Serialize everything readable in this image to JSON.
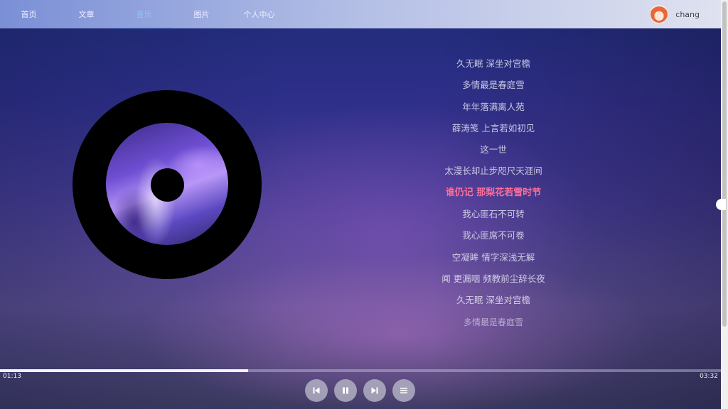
{
  "nav": {
    "items": [
      {
        "label": "首页"
      },
      {
        "label": "文章"
      },
      {
        "label": "音乐"
      },
      {
        "label": "图片"
      },
      {
        "label": "个人中心"
      }
    ],
    "active_index": 2
  },
  "user": {
    "name": "chang"
  },
  "lyrics": [
    {
      "text": "久无眠 深坐对宫檐"
    },
    {
      "text": "多情最是春庭雪"
    },
    {
      "text": "年年落满离人苑"
    },
    {
      "text": "薛涛笺 上言若如初见"
    },
    {
      "text": "这一世"
    },
    {
      "text": "太漫长却止步咫尺天涯间"
    },
    {
      "text": "谁仍记 那梨花若雪时节"
    },
    {
      "text": "我心匪石不可转"
    },
    {
      "text": "我心匪席不可卷"
    },
    {
      "text": "空凝眸 情字深浅无解"
    },
    {
      "text": "闻 更漏咽 频教前尘辞长夜"
    },
    {
      "text": "久无眠 深坐对宫檐"
    },
    {
      "text": "多情最是春庭雪"
    }
  ],
  "current_lyric_index": 6,
  "player": {
    "current_time": "01:13",
    "total_time": "03:32",
    "progress": 0.344
  },
  "controls": {
    "prev_icon": "skip-back-icon",
    "pause_icon": "pause-icon",
    "next_icon": "skip-forward-icon",
    "list_icon": "playlist-icon"
  },
  "colors": {
    "active_nav": "#8fc3ff",
    "current_lyric": "#ff6f9a"
  }
}
